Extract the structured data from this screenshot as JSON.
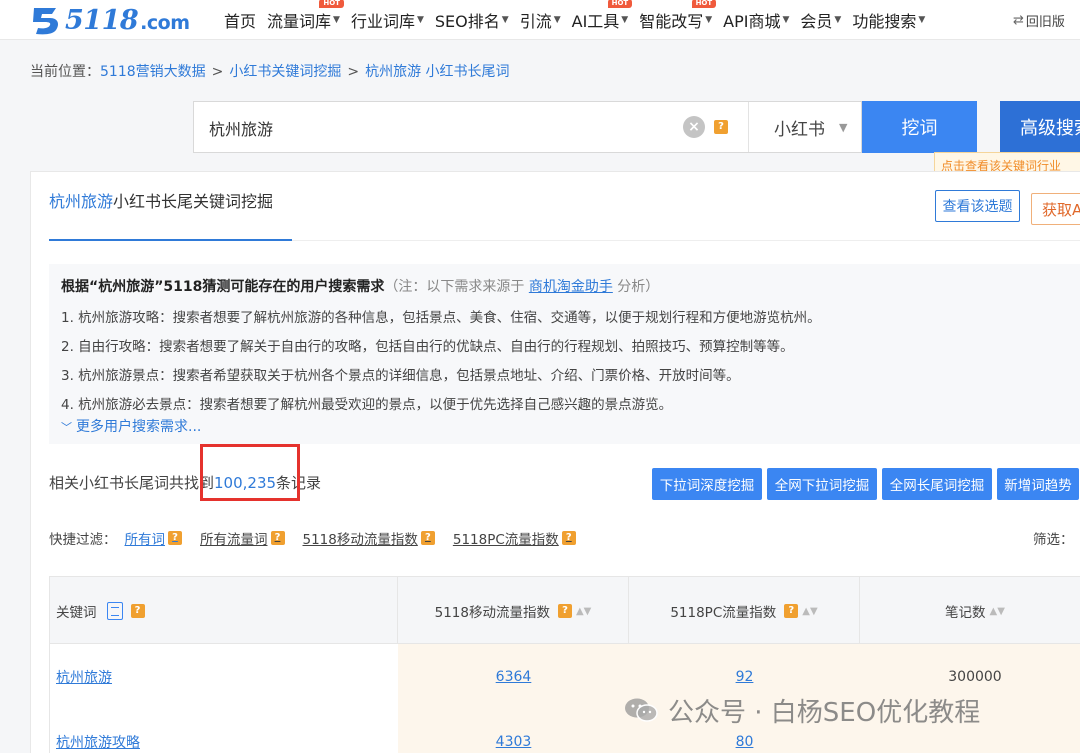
{
  "nav": {
    "logo_text": "5118",
    "logo_suffix": ".com",
    "items": [
      {
        "label": "首页",
        "caret": false,
        "hot": false
      },
      {
        "label": "流量词库",
        "caret": true,
        "hot": true
      },
      {
        "label": "行业词库",
        "caret": true,
        "hot": false
      },
      {
        "label": "SEO排名",
        "caret": true,
        "hot": false
      },
      {
        "label": "引流",
        "caret": true,
        "hot": false
      },
      {
        "label": "AI工具",
        "caret": true,
        "hot": true
      },
      {
        "label": "智能改写",
        "caret": true,
        "hot": true
      },
      {
        "label": "API商城",
        "caret": true,
        "hot": false
      },
      {
        "label": "会员",
        "caret": true,
        "hot": false
      },
      {
        "label": "功能搜索",
        "caret": true,
        "hot": false
      }
    ],
    "hot_label": "HOT",
    "old_version": "回旧版"
  },
  "breadcrumb": {
    "prefix": "当前位置：",
    "items": [
      "5118营销大数据",
      "小红书关键词挖掘",
      "杭州旅游 小红书长尾词"
    ]
  },
  "search": {
    "value": "杭州旅游",
    "help": "?",
    "platform": "小红书",
    "dig_button": "挖词",
    "advanced_button": "高级搜索",
    "tooltip": "点击查看该关键词行业"
  },
  "panel": {
    "keyword": "杭州旅游",
    "title_rest": "小红书长尾关键词挖掘",
    "topic_button": "查看该选题",
    "get_button": "获取AI"
  },
  "needs": {
    "title_bold": "根据“杭州旅游”5118猜测可能存在的用户搜索需求",
    "note_prefix": "（注：以下需求来源于",
    "note_link": "商机淘金助手",
    "note_suffix": "分析）",
    "items": [
      "1. 杭州旅游攻略：搜索者想要了解杭州旅游的各种信息，包括景点、美食、住宿、交通等，以便于规划行程和方便地游览杭州。",
      "2. 自由行攻略：搜索者想要了解关于自由行的攻略，包括自由行的优缺点、自由行的行程规划、拍照技巧、预算控制等等。",
      "3. 杭州旅游景点：搜索者希望获取关于杭州各个景点的详细信息，包括景点地址、介绍、门票价格、开放时间等。",
      "4. 杭州旅游必去景点：搜索者想要了解杭州最受欢迎的景点，以便于优先选择自己感兴趣的景点游览。"
    ],
    "more": "更多用户搜索需求..."
  },
  "results": {
    "prefix": "相关小红书长尾词共找到",
    "count": "100,235",
    "suffix": "条记录",
    "actions": [
      "下拉词深度挖掘",
      "全网下拉词挖掘",
      "全网长尾词挖掘",
      "新增词趋势"
    ]
  },
  "filters": {
    "label": "快捷过滤：",
    "items": [
      "所有词",
      "所有流量词",
      "5118移动流量指数",
      "5118PC流量指数"
    ],
    "screen_label": "筛选："
  },
  "table": {
    "headers": [
      "关键词",
      "5118移动流量指数",
      "5118PC流量指数",
      "笔记数"
    ],
    "rows": [
      {
        "keyword": "杭州旅游",
        "mobile": "6364",
        "pc": "92",
        "notes": "300000"
      },
      {
        "keyword": "杭州旅游攻略",
        "mobile": "4303",
        "pc": "80",
        "notes": ""
      }
    ]
  },
  "watermark": "公众号 · 白杨SEO优化教程"
}
